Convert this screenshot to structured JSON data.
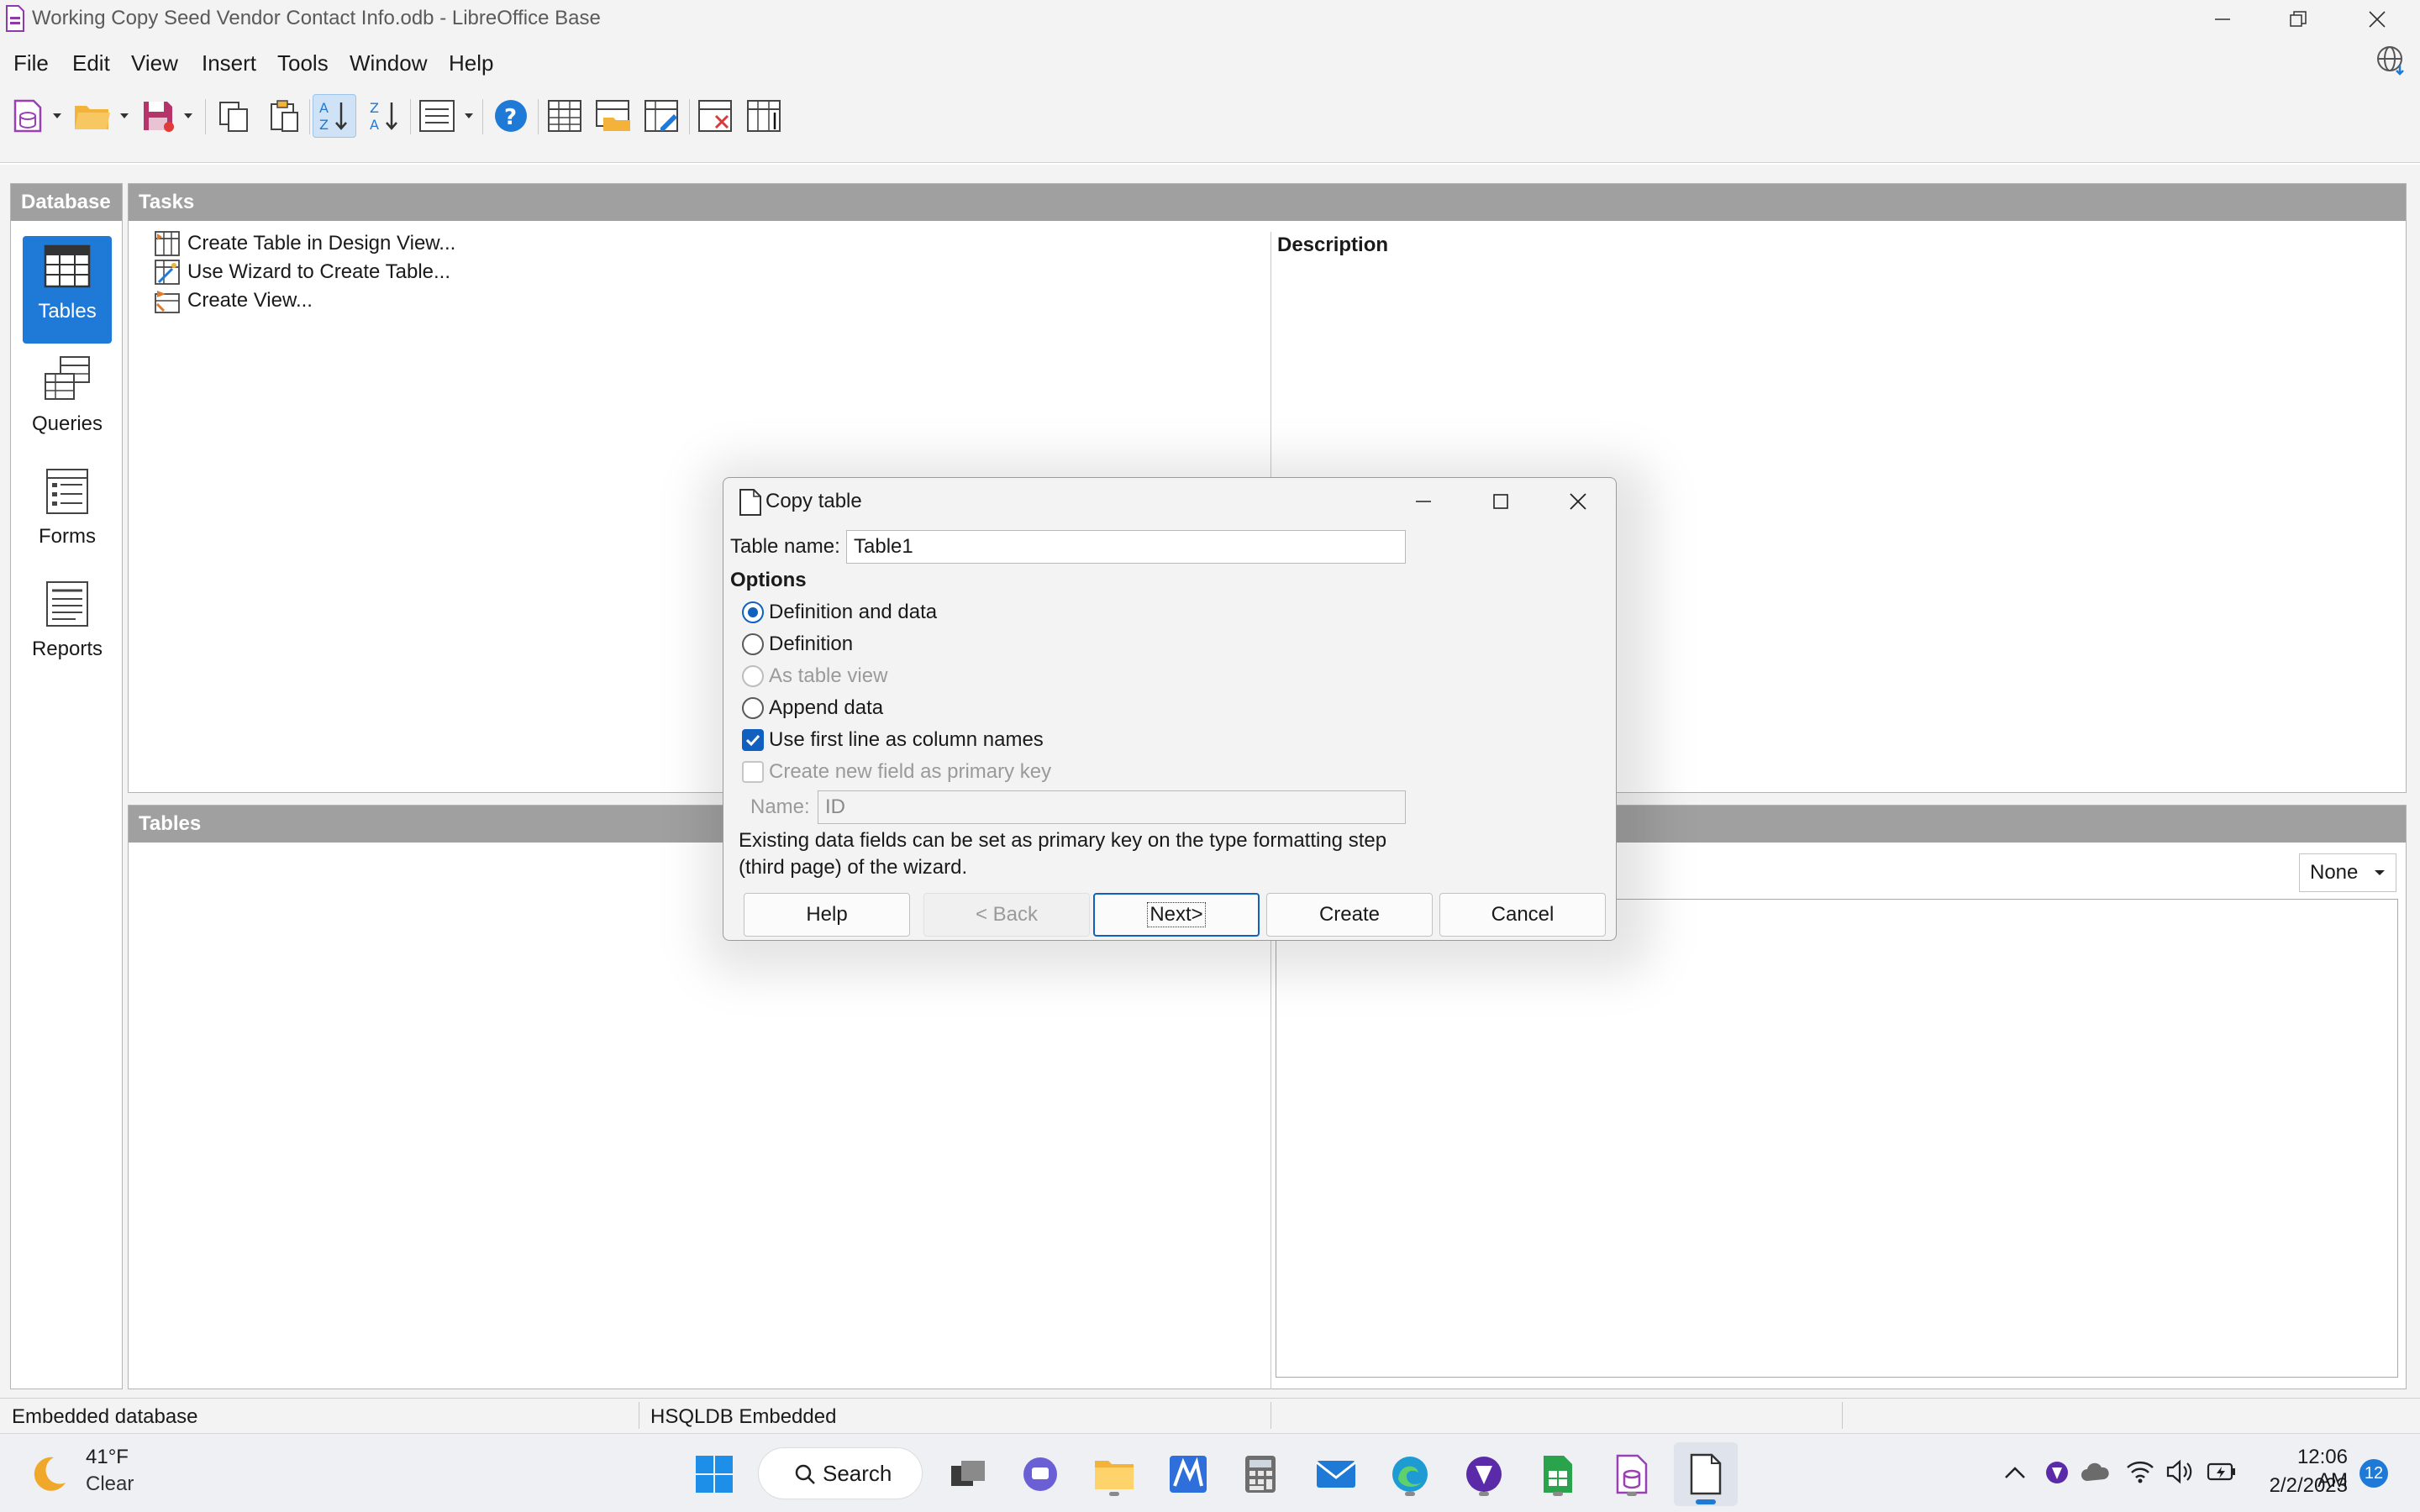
{
  "window": {
    "title": "Working Copy Seed Vendor Contact Info.odb - LibreOffice Base"
  },
  "menu": [
    "File",
    "Edit",
    "View",
    "Insert",
    "Tools",
    "Window",
    "Help"
  ],
  "database_panel": {
    "header": "Database",
    "items": [
      {
        "label": "Tables",
        "icon": "tables-icon",
        "active": true
      },
      {
        "label": "Queries",
        "icon": "queries-icon",
        "active": false
      },
      {
        "label": "Forms",
        "icon": "forms-icon",
        "active": false
      },
      {
        "label": "Reports",
        "icon": "reports-icon",
        "active": false
      }
    ]
  },
  "tasks_panel": {
    "header": "Tasks",
    "tasks": [
      "Create Table in Design View...",
      "Use Wizard to Create Table...",
      "Create View..."
    ],
    "description_label": "Description"
  },
  "tables_panel": {
    "header": "Tables",
    "preview_option": "None"
  },
  "statusbar": {
    "left": "Embedded database",
    "middle": "HSQLDB Embedded"
  },
  "taskbar": {
    "weather_temp": "41°F",
    "weather_cond": "Clear",
    "search_label": "Search",
    "time": "12:06 AM",
    "date": "2/2/2023",
    "notification_count": "12"
  },
  "dialog": {
    "title": "Copy table",
    "table_name_label": "Table name:",
    "table_name_value": "Table1",
    "options_header": "Options",
    "options": [
      {
        "label": "Definition and data",
        "selected": true,
        "enabled": true
      },
      {
        "label": "Definition",
        "selected": false,
        "enabled": true
      },
      {
        "label": "As table view",
        "selected": false,
        "enabled": false
      },
      {
        "label": "Append data",
        "selected": false,
        "enabled": true
      }
    ],
    "use_first_line": {
      "label": "Use first line as column names",
      "checked": true
    },
    "create_primary_key": {
      "label": "Create new field as primary key",
      "checked": false,
      "enabled": false
    },
    "key_name_label": "Name:",
    "key_name_value": "ID",
    "info_line1": "Existing data fields can be set as primary key on the type formatting step",
    "info_line2": "(third page) of the wizard.",
    "buttons": {
      "help": "Help",
      "back": "< Back",
      "next": "Next>",
      "create": "Create",
      "cancel": "Cancel"
    }
  },
  "colors": {
    "accent": "#1e7ad6",
    "panel_header": "#a0a0a0",
    "window_bg": "#f3f3f3"
  }
}
